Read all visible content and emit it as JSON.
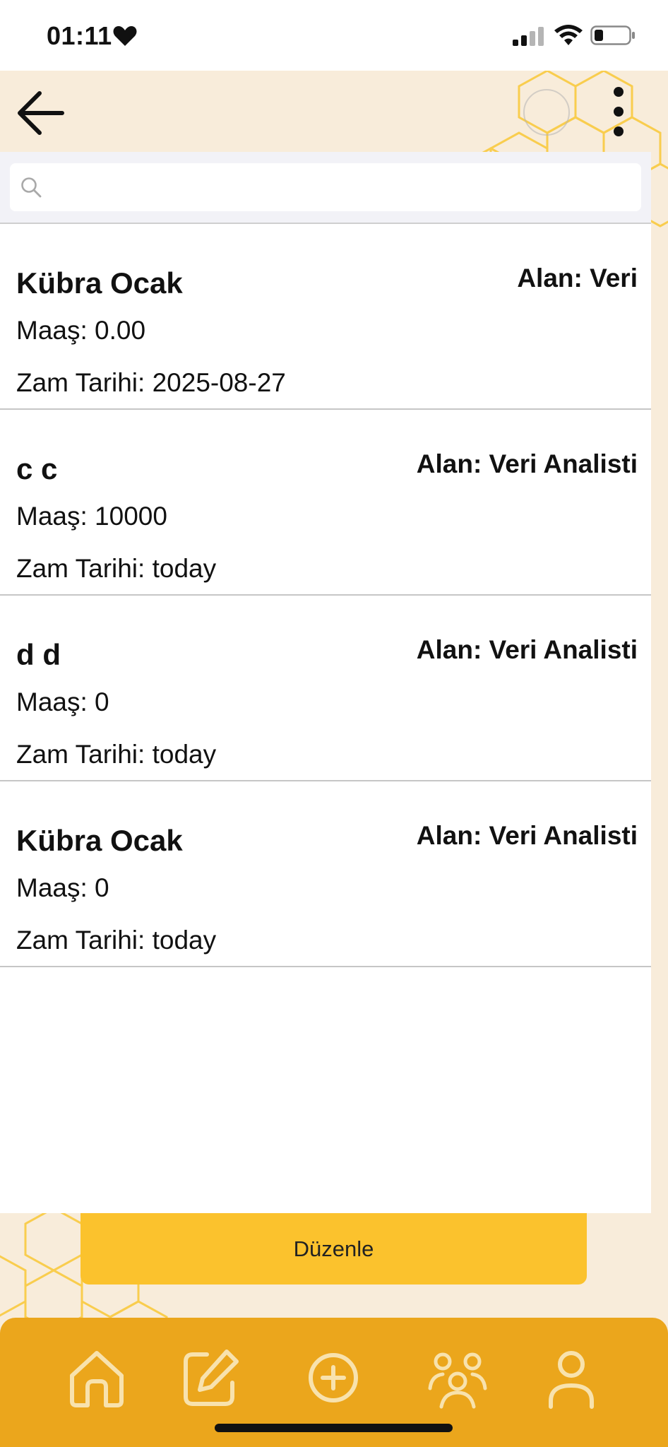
{
  "status_bar": {
    "time": "01:11"
  },
  "search": {
    "placeholder": "",
    "value": ""
  },
  "employees": [
    {
      "name": "Kübra Ocak",
      "area": "Alan: Veri",
      "salary": "Maaş: 0.00",
      "raise_date": "Zam Tarihi: 2025-08-27"
    },
    {
      "name": "c c",
      "area": "Alan: Veri Analisti",
      "salary": "Maaş: 10000",
      "raise_date": "Zam Tarihi: today"
    },
    {
      "name": "d d",
      "area": "Alan: Veri Analisti",
      "salary": "Maaş: 0",
      "raise_date": "Zam Tarihi: today"
    },
    {
      "name": "Kübra Ocak",
      "area": "Alan: Veri Analisti",
      "salary": "Maaş: 0",
      "raise_date": "Zam Tarihi: today"
    }
  ],
  "actions": {
    "edit_label": "Düzenle"
  },
  "bottom_nav": {
    "items": [
      {
        "icon": "home-icon"
      },
      {
        "icon": "edit-icon"
      },
      {
        "icon": "add-icon"
      },
      {
        "icon": "team-icon"
      },
      {
        "icon": "profile-icon"
      }
    ]
  },
  "colors": {
    "background": "#f8ecda",
    "honeycomb": "#f7c744",
    "edit_button": "#fbc22d",
    "nav_bar": "#eba61c"
  }
}
